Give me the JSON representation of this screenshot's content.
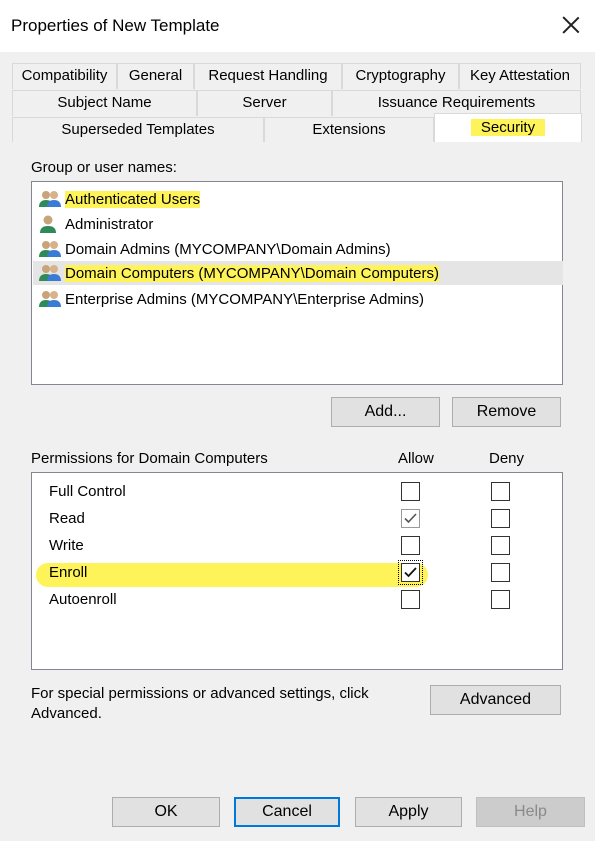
{
  "window": {
    "title": "Properties of New Template",
    "close_icon": "close-icon"
  },
  "tabs": {
    "row1": [
      "Compatibility",
      "General",
      "Request Handling",
      "Cryptography",
      "Key Attestation"
    ],
    "row2": [
      "Subject Name",
      "Server",
      "Issuance Requirements"
    ],
    "row3": [
      "Superseded Templates",
      "Extensions",
      "Security"
    ],
    "active": "Security"
  },
  "group_list": {
    "label": "Group or user names:",
    "items": [
      {
        "name": "Authenticated Users",
        "icon": "group-users-icon",
        "highlighted": true
      },
      {
        "name": "Administrator",
        "icon": "user-icon",
        "highlighted": false
      },
      {
        "name": "Domain Admins (MYCOMPANY\\Domain Admins)",
        "icon": "group-users-icon",
        "highlighted": false
      },
      {
        "name": "Domain Computers (MYCOMPANY\\Domain Computers)",
        "icon": "group-users-icon",
        "highlighted": true,
        "selected": true
      },
      {
        "name": "Enterprise Admins (MYCOMPANY\\Enterprise Admins)",
        "icon": "group-users-icon",
        "highlighted": false
      }
    ],
    "add_label": "Add...",
    "remove_label": "Remove"
  },
  "permissions": {
    "label": "Permissions for Domain Computers",
    "allow_header": "Allow",
    "deny_header": "Deny",
    "rows": [
      {
        "name": "Full Control",
        "allow": false,
        "allow_greyed": false,
        "deny": false
      },
      {
        "name": "Read",
        "allow": true,
        "allow_greyed": true,
        "deny": false
      },
      {
        "name": "Write",
        "allow": false,
        "allow_greyed": false,
        "deny": false
      },
      {
        "name": "Enroll",
        "allow": true,
        "allow_greyed": false,
        "deny": false,
        "highlighted": true
      },
      {
        "name": "Autoenroll",
        "allow": false,
        "allow_greyed": false,
        "deny": false
      }
    ]
  },
  "advanced": {
    "text_line1": "For special permissions or advanced settings, click",
    "text_line2": "Advanced.",
    "button_label": "Advanced"
  },
  "footer": {
    "ok_label": "OK",
    "cancel_label": "Cancel",
    "apply_label": "Apply",
    "help_label": "Help"
  },
  "colors": {
    "highlight": "#fff35a",
    "accent": "#0078d7"
  }
}
